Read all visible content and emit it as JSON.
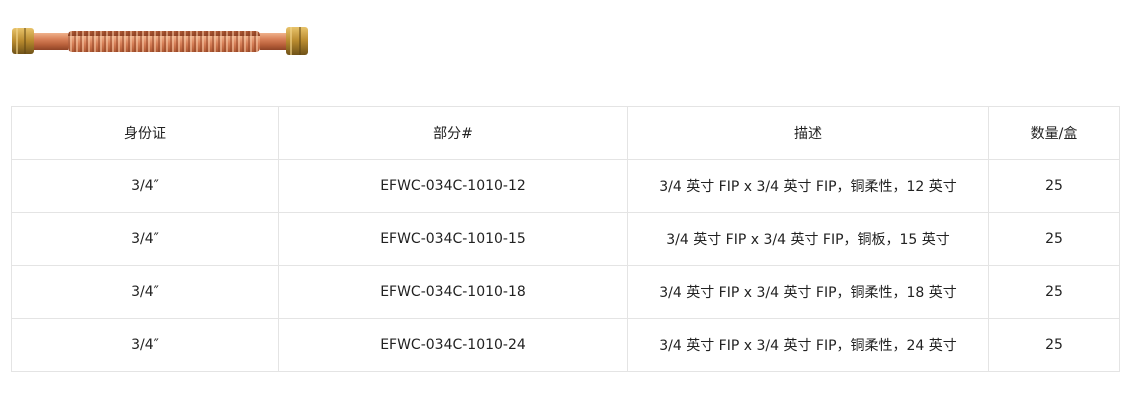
{
  "table": {
    "headers": [
      "身份证",
      "部分#",
      "描述",
      "数量/盒"
    ],
    "rows": [
      [
        "3/4″",
        "EFWC-034C-1010-12",
        "3/4 英寸 FIP x 3/4 英寸 FIP，铜柔性，12 英寸",
        "25"
      ],
      [
        "3/4″",
        "EFWC-034C-1010-15",
        "3/4 英寸 FIP x 3/4 英寸 FIP，铜板，15 英寸",
        "25"
      ],
      [
        "3/4″",
        "EFWC-034C-1010-18",
        "3/4 英寸 FIP x 3/4 英寸 FIP，铜柔性，18 英寸",
        "25"
      ],
      [
        "3/4″",
        "EFWC-034C-1010-24",
        "3/4 英寸 FIP x 3/4 英寸 FIP，铜柔性，24 英寸",
        "25"
      ]
    ]
  }
}
